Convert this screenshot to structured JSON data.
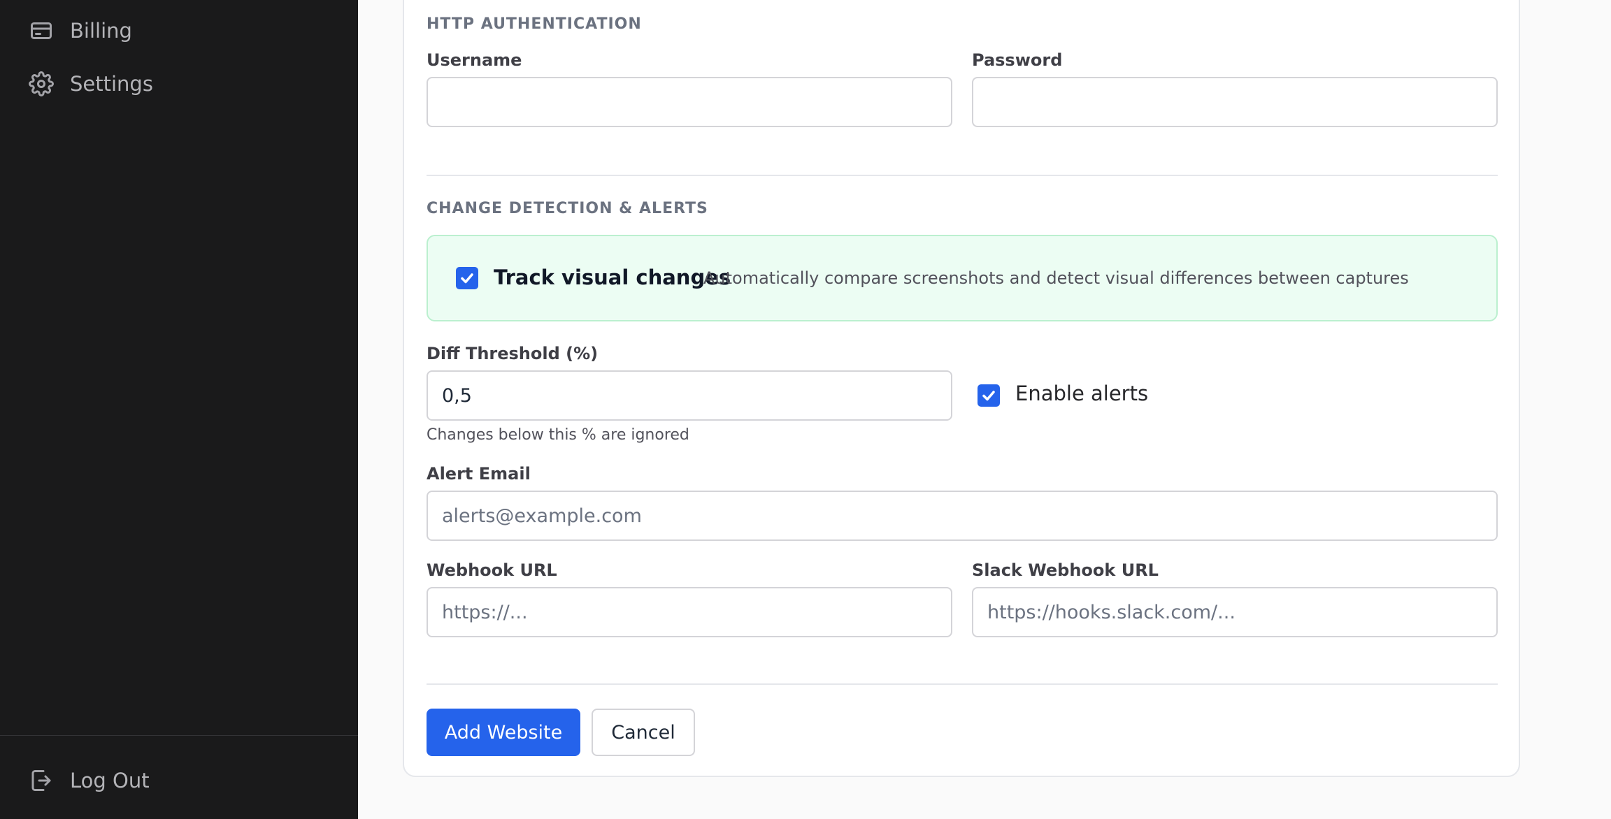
{
  "sidebar": {
    "items": [
      {
        "label": "Billing",
        "icon": "credit-card-icon"
      },
      {
        "label": "Settings",
        "icon": "gear-icon"
      }
    ],
    "logout": {
      "label": "Log Out",
      "icon": "logout-icon"
    }
  },
  "http_auth": {
    "title": "HTTP AUTHENTICATION",
    "username_label": "Username",
    "username_value": "",
    "password_label": "Password",
    "password_value": ""
  },
  "change_detection": {
    "title": "CHANGE DETECTION & ALERTS",
    "track_visual_label": "Track visual changes",
    "track_visual_checked": true,
    "track_visual_description": "Automatically compare screenshots and detect visual differences between captures",
    "diff_threshold_label": "Diff Threshold (%)",
    "diff_threshold_value": "0,5",
    "diff_threshold_hint": "Changes below this % are ignored",
    "enable_alerts_label": "Enable alerts",
    "enable_alerts_checked": true,
    "alert_email_label": "Alert Email",
    "alert_email_placeholder": "alerts@example.com",
    "webhook_label": "Webhook URL",
    "webhook_placeholder": "https://...",
    "slack_webhook_label": "Slack Webhook URL",
    "slack_webhook_placeholder": "https://hooks.slack.com/..."
  },
  "actions": {
    "submit_label": "Add Website",
    "cancel_label": "Cancel"
  },
  "colors": {
    "primary": "#2563eb",
    "sidebar_bg": "#1a1a1b",
    "success_bg": "#ecfdf3",
    "success_border": "#bbf0cf"
  }
}
